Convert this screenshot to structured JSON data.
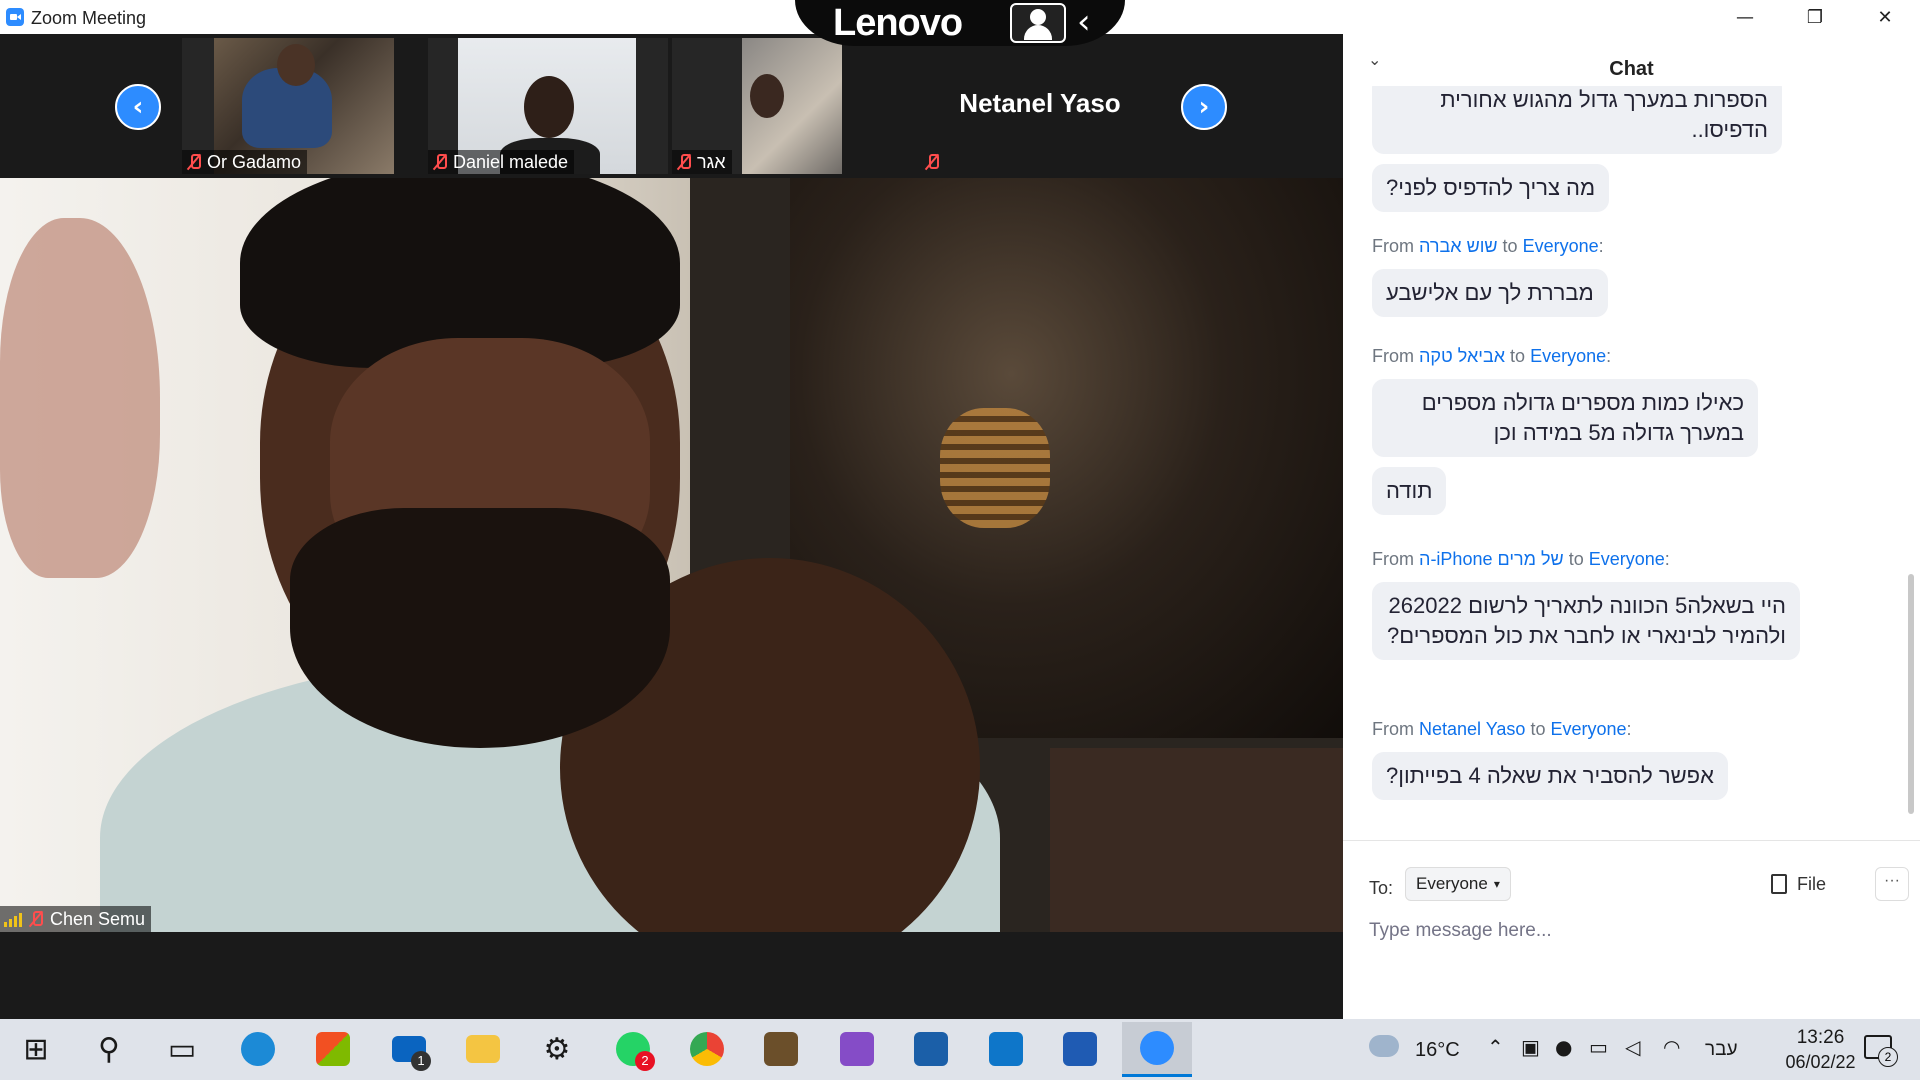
{
  "window": {
    "title": "Zoom Meeting",
    "minimize_glyph": "—",
    "maximize_glyph": "❐",
    "close_glyph": "✕"
  },
  "overlay": {
    "brand": "Lenovo",
    "back_glyph": "‹"
  },
  "gallery": {
    "prev_glyph": "‹",
    "next_glyph": "›",
    "participants": [
      {
        "name": "Or Gadamo",
        "muted": true
      },
      {
        "name": "Daniel malede",
        "muted": true
      },
      {
        "name": "אגר",
        "muted": true
      },
      {
        "name": "Netanel Yaso",
        "muted": true,
        "video": false
      }
    ]
  },
  "main_video": {
    "speaker_name": "Chen Semu",
    "signal_color": "#f0c419"
  },
  "chat": {
    "title": "Chat",
    "collapse_glyph": "⌄",
    "messages": [
      {
        "sender": "",
        "to": "",
        "texts": [
          "הספרות במערך גדול מהגוש אחורית הדפיסו..",
          "מה צריך להדפיס לפני?"
        ]
      },
      {
        "sender": "שוש אברה",
        "to": "Everyone",
        "texts": [
          "מבררת לך עם אלישבע"
        ]
      },
      {
        "sender": "אביאל טקה",
        "to": "Everyone",
        "texts": [
          "כאילו כמות מספרים גדולה מספרים במערך גדולה מ5 במידה וכן",
          "תודה"
        ]
      },
      {
        "sender": "ה-iPhone של מרים",
        "to": "Everyone",
        "texts": [
          "היי בשאלה5 הכוונה לתאריך לרשום 262022 ולהמיר לבינארי או לחבר את כול המספרים?"
        ]
      },
      {
        "sender": "Netanel Yaso",
        "to": "Everyone",
        "texts": [
          "אפשר להסביר את שאלה 4 בפייתון?"
        ]
      }
    ],
    "from_word": "From",
    "to_word": "to",
    "footer": {
      "to_label": "To:",
      "recipient": "Everyone",
      "file_label": "File",
      "more_glyph": "···",
      "input_placeholder": "Type message here..."
    },
    "accent_color": "#0e71eb"
  },
  "taskbar": {
    "apps": [
      {
        "name": "start",
        "glyph": "⊞"
      },
      {
        "name": "search",
        "glyph": "⚲"
      },
      {
        "name": "task-view",
        "glyph": "▭"
      },
      {
        "name": "edge",
        "color": "#1c8ad6"
      },
      {
        "name": "store",
        "color": "#f25022"
      },
      {
        "name": "mail",
        "color": "#0a64c0",
        "badge": "1"
      },
      {
        "name": "file-explorer",
        "color": "#f4c542"
      },
      {
        "name": "settings",
        "glyph": "⚙"
      },
      {
        "name": "whatsapp",
        "color": "#25d366",
        "badge": "2"
      },
      {
        "name": "chrome",
        "color": "#ea4335"
      },
      {
        "name": "app-generic",
        "color": "#6b4f2a"
      },
      {
        "name": "visual-studio",
        "color": "#854cc7"
      },
      {
        "name": "powershell",
        "color": "#1b5fa8"
      },
      {
        "name": "vscode",
        "color": "#0e76c9"
      },
      {
        "name": "word",
        "color": "#1f5bb3"
      },
      {
        "name": "zoom",
        "color": "#2d8cff",
        "active": true
      }
    ],
    "tray": {
      "temperature": "16°C",
      "chevron_glyph": "⌃",
      "language": "עבר",
      "time": "13:26",
      "date": "06/02/22",
      "notifications": "2"
    }
  }
}
